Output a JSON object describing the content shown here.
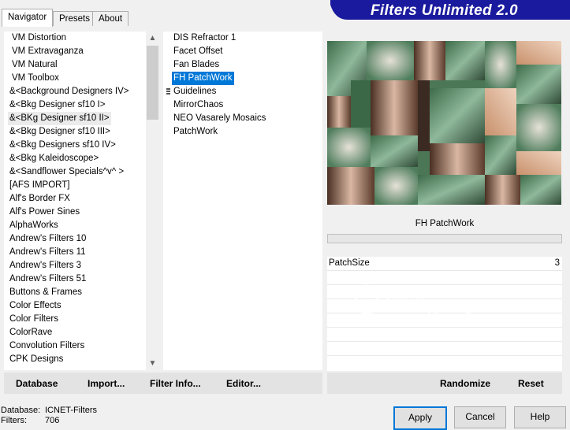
{
  "tabs": [
    "Navigator",
    "Presets",
    "About"
  ],
  "banner_title": "Filters Unlimited 2.0",
  "categories": [
    "VM Distortion",
    "VM Extravaganza",
    "VM Natural",
    "VM Toolbox",
    "&<Background Designers IV>",
    "&<Bkg Designer sf10 I>",
    "&<BKg Designer sf10 II>",
    "&<Bkg Designer sf10 III>",
    "&<Bkg Designers sf10 IV>",
    "&<Bkg Kaleidoscope>",
    "&<Sandflower Specials^v^ >",
    "[AFS IMPORT]",
    "Alf's Border FX",
    "Alf's Power Sines",
    "AlphaWorks",
    "Andrew's Filters 10",
    "Andrew's Filters 11",
    "Andrew's Filters 3",
    "Andrew's Filters 51",
    "Buttons & Frames",
    "Color Effects",
    "Color Filters",
    "ColorRave",
    "Convolution Filters",
    "CPK Designs"
  ],
  "filters": [
    "DIS Refractor 1",
    "Facet Offset",
    "Fan Blades",
    "FH PatchWork",
    "Guidelines",
    "MirrorChaos",
    "NEO Vasarely Mosaics",
    "PatchWork"
  ],
  "selected_filter_name": "FH PatchWork",
  "params": [
    {
      "label": "PatchSize",
      "value": "3"
    }
  ],
  "left_buttons": [
    "Database",
    "Import...",
    "Filter Info...",
    "Editor..."
  ],
  "right_buttons": [
    "Randomize",
    "Reset"
  ],
  "status": {
    "db_label": "Database:",
    "db_value": "ICNET-Filters",
    "filters_label": "Filters:",
    "filters_value": "706"
  },
  "dialog_buttons": [
    "Apply",
    "Cancel",
    "Help"
  ],
  "watermark": {
    "name": "Pinuccia",
    "site": "www.maidiregrafica.eu"
  },
  "colors": {
    "accent": "#0078d7",
    "banner": "#1a1a9e",
    "selection": "#0078d7"
  }
}
